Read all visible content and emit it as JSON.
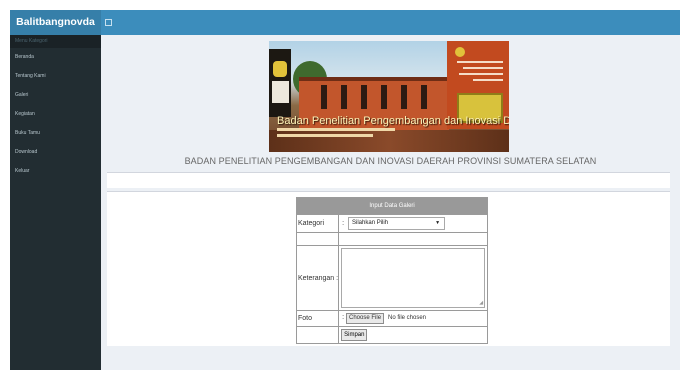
{
  "sidebar": {
    "brand": "Balitbangnovda",
    "header": "Menu Kategori",
    "items": [
      {
        "label": "Beranda"
      },
      {
        "label": "Tentang Kami"
      },
      {
        "label": "Galeri"
      },
      {
        "label": "Kegiatan"
      },
      {
        "label": "Buku Tamu"
      },
      {
        "label": "Download"
      },
      {
        "label": "Keluar"
      }
    ]
  },
  "topbar": {
    "toggle_icon": "menu-toggle-icon"
  },
  "banner": {
    "caption": "Badan Penelitian Pengembangan dan Inovasi Daerah"
  },
  "main": {
    "institution_title": "BADAN PENELITIAN PENGEMBANGAN DAN INOVASI DAERAH PROVINSI SUMATERA SELATAN"
  },
  "form": {
    "title": "Input Data Galeri",
    "kategori_label": "Kategori",
    "kategori_value": "Silahkan Pilih",
    "keterangan_label": "Keterangan",
    "foto_label": "Foto",
    "file_button": "Choose File",
    "file_status": "No file chosen",
    "submit_label": "Simpan",
    "separator": ":"
  },
  "colors": {
    "brand": "#367fa9",
    "topbar": "#3c8dbc",
    "sidebar": "#222d32",
    "content": "#ecf0f5"
  }
}
